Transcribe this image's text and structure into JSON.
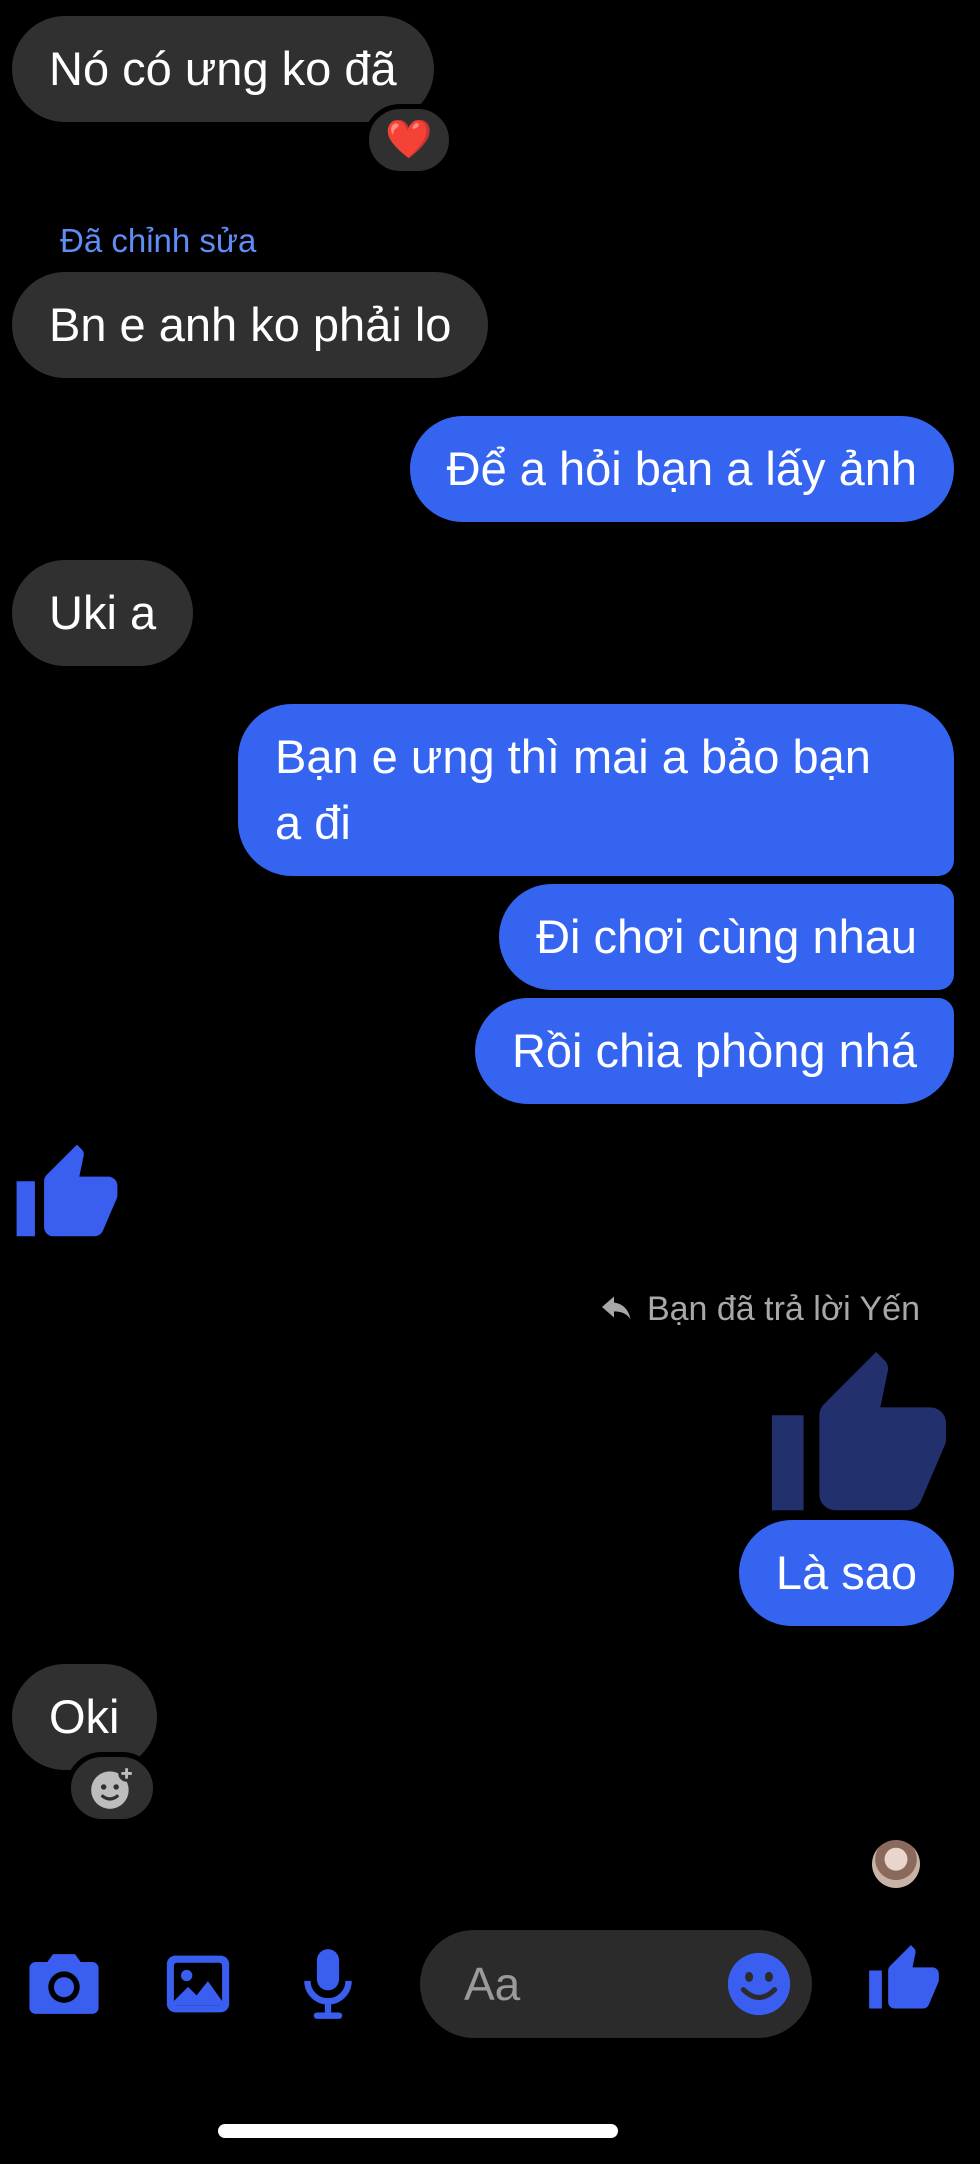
{
  "messages": {
    "m1": "Nó có ưng ko đã",
    "m1_reaction": "❤️",
    "edited_label": "Đã chỉnh sửa",
    "m2": "Bn e anh ko phải lo",
    "m3": "Để a hỏi bạn a lấy ảnh",
    "m4": "Uki a",
    "m5_line1": "Bạn e ưng thì mai a bảo bạn",
    "m5_line2": "a đi",
    "m6": "Đi chơi cùng nhau",
    "m7": "Rồi chia phòng nhá",
    "reply_note": "Bạn đã trả lời Yến",
    "m8": "Là sao",
    "m9": "Oki"
  },
  "composer": {
    "placeholder": "Aa"
  },
  "colors": {
    "outgoing": "#3565f0",
    "incoming": "#303030",
    "accent": "#3a5ff0",
    "edited": "#5f8df5"
  },
  "icons": {
    "toolbar": [
      "camera-icon",
      "gallery-icon",
      "microphone-icon",
      "emoji-icon",
      "thumbs-up-icon"
    ],
    "reactions": [
      "heart-emoji",
      "add-reaction-icon"
    ],
    "reply": "reply-arrow-icon"
  }
}
